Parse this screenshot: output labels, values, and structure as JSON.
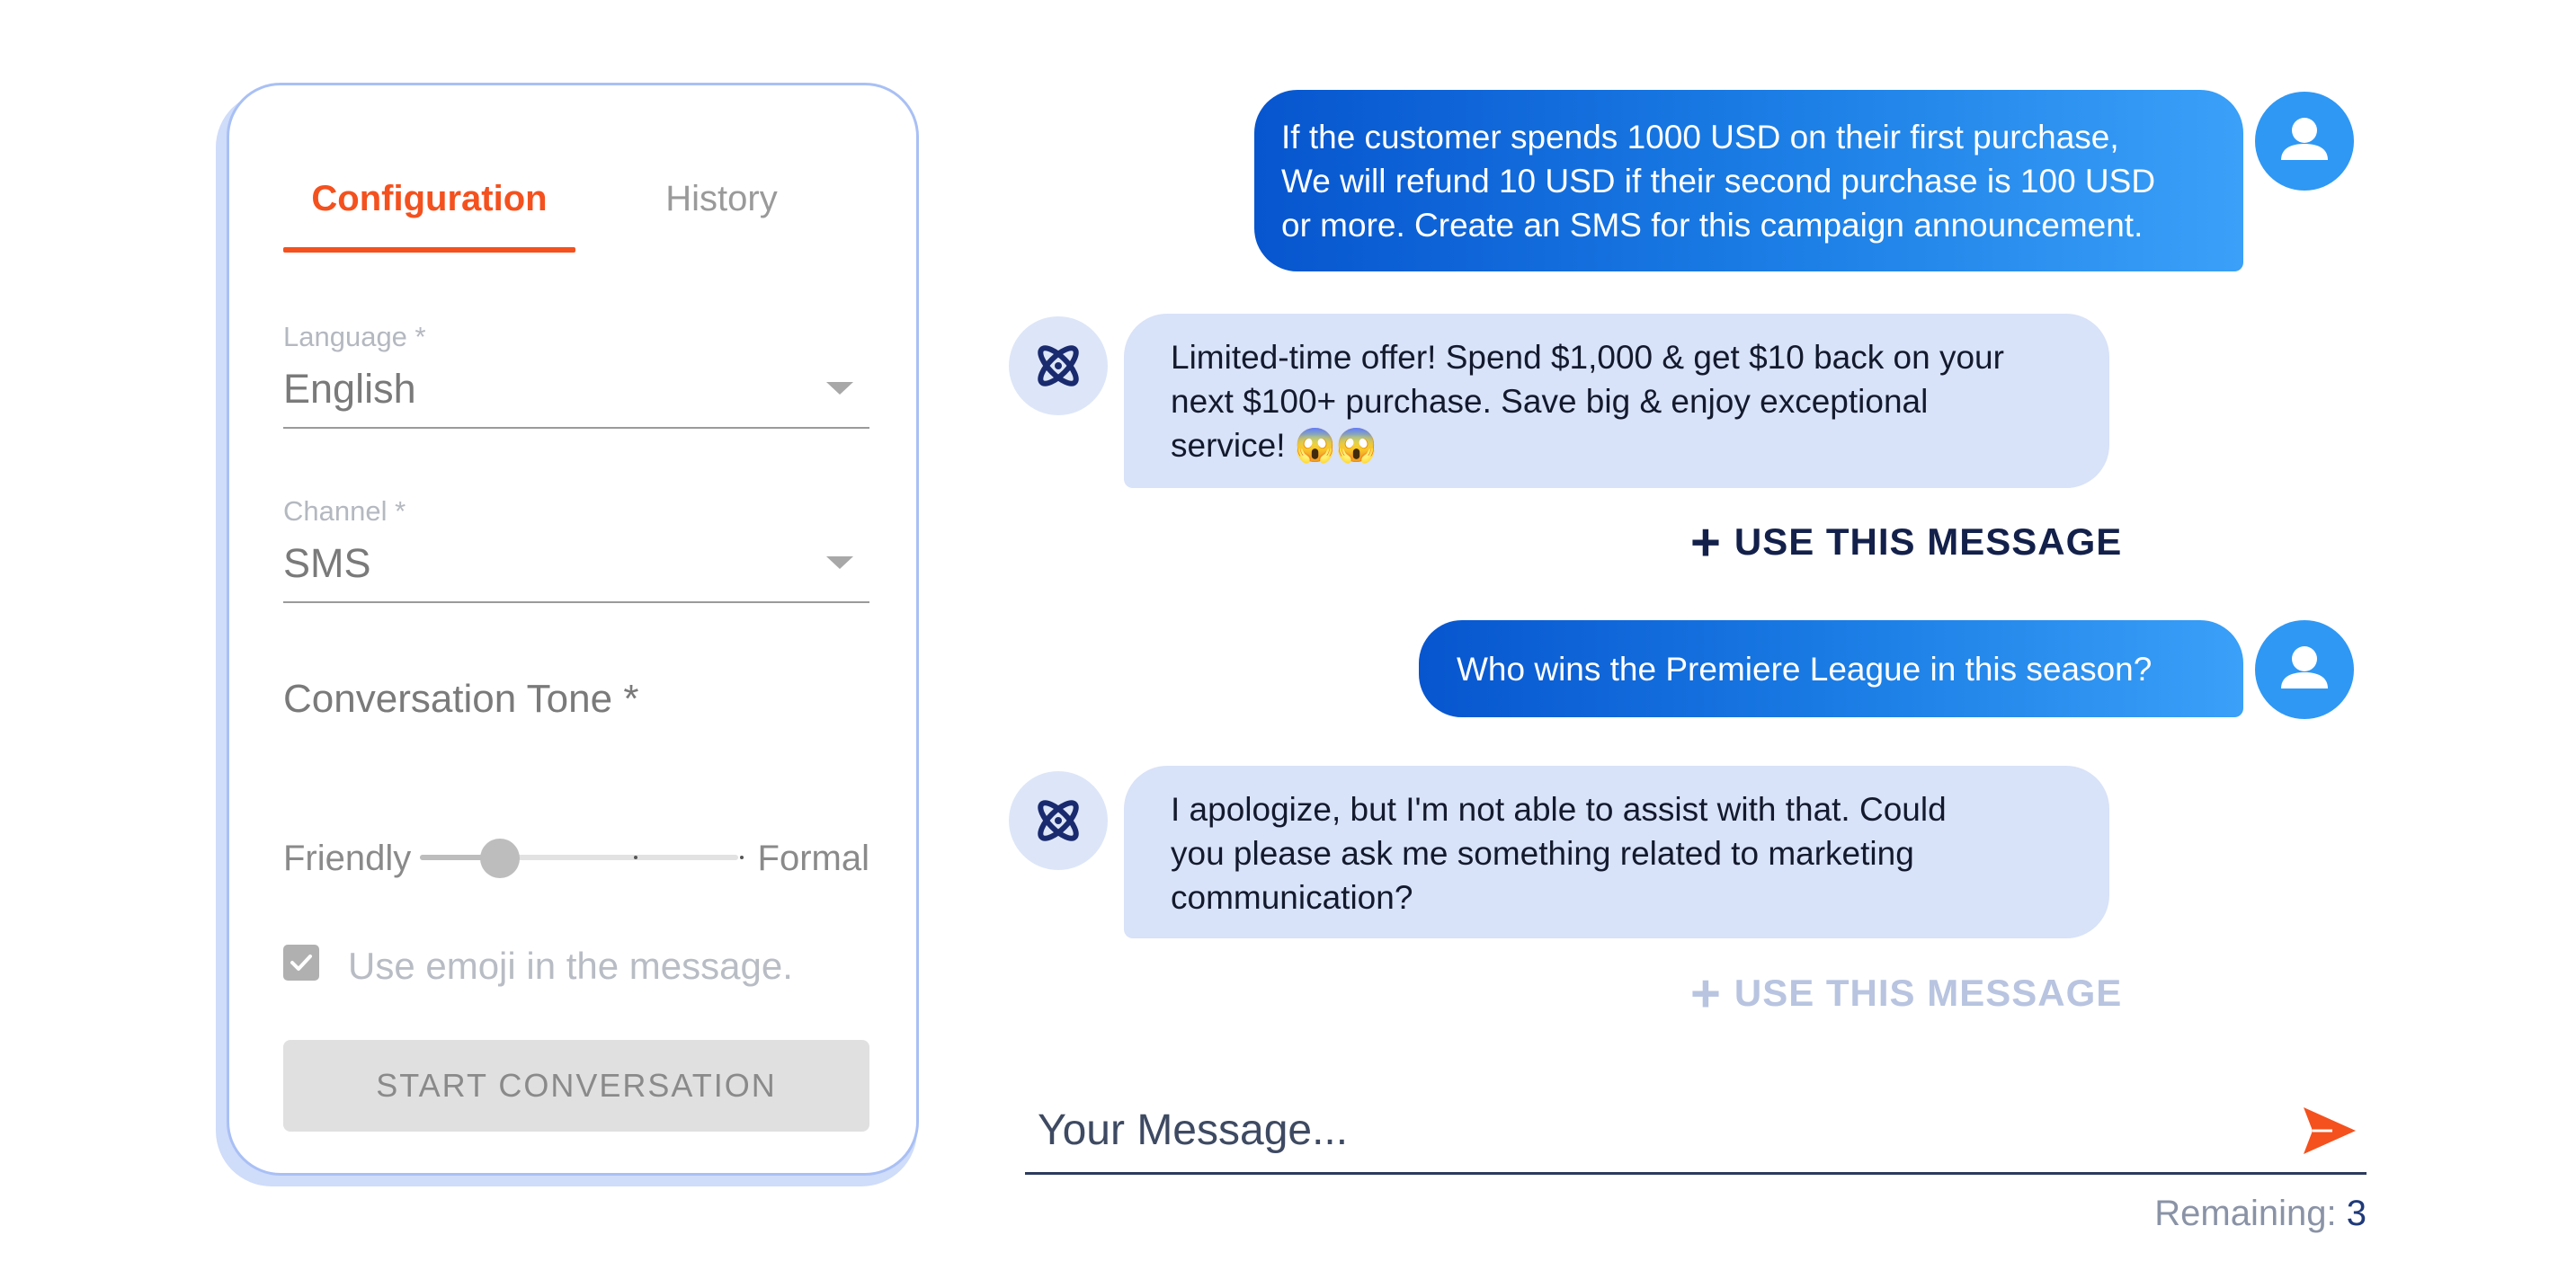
{
  "config_panel": {
    "tabs": [
      {
        "label": "Configuration",
        "active": true
      },
      {
        "label": "History",
        "active": false
      }
    ],
    "language": {
      "label": "Language *",
      "value": "English"
    },
    "channel": {
      "label": "Channel *",
      "value": "SMS"
    },
    "tone": {
      "title": "Conversation Tone *",
      "min_label": "Friendly",
      "max_label": "Formal",
      "level_percent": 25
    },
    "emoji_option": {
      "label": "Use emoji in the message.",
      "checked": true
    },
    "start_button": "START CONVERSATION"
  },
  "chat": {
    "messages": [
      {
        "role": "user",
        "text": "If the customer spends 1000 USD on their first purchase,\nWe will refund 10 USD if their second purchase is 100 USD\nor more. Create an SMS for this campaign announcement."
      },
      {
        "role": "assistant",
        "text": "Limited-time offer! Spend $1,000 & get $10 back on your\nnext $100+ purchase. Save big & enjoy exceptional\nservice! 😱😱",
        "action": "USE THIS MESSAGE",
        "action_enabled": true
      },
      {
        "role": "user",
        "text": "Who wins the Premiere League in this season?"
      },
      {
        "role": "assistant",
        "text": "I apologize, but I'm not able to assist with that. Could\nyou please ask me something related to marketing\ncommunication?",
        "action": "USE THIS MESSAGE",
        "action_enabled": false
      }
    ],
    "input_placeholder": "Your Message...",
    "remaining_label": "Remaining:",
    "remaining_count": "3"
  },
  "colors": {
    "accent": "#f4511e",
    "user_bubble_start": "#0755cf",
    "user_bubble_end": "#3aa0f8",
    "bot_bubble": "#d8e2f8",
    "navy": "#13204a"
  },
  "icons": {
    "user_avatar": "person-icon",
    "bot_avatar": "atom-icon",
    "send": "send-icon",
    "use_message": "plus-icon",
    "dropdown": "caret-down-icon",
    "checkbox": "check-icon"
  }
}
